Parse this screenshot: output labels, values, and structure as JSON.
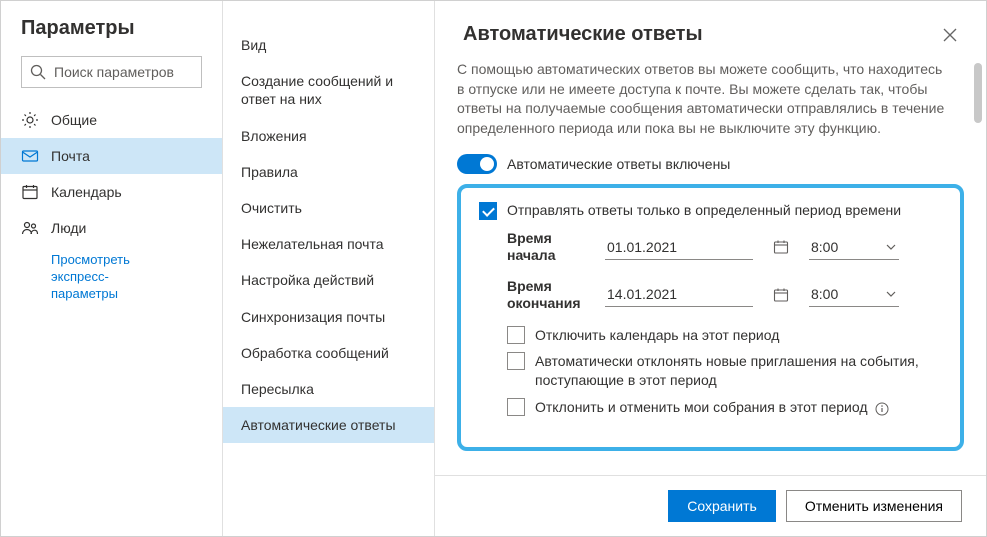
{
  "left": {
    "title": "Параметры",
    "search_placeholder": "Поиск параметров",
    "items": [
      {
        "icon": "gear",
        "label": "Общие"
      },
      {
        "icon": "mail",
        "label": "Почта"
      },
      {
        "icon": "calendar",
        "label": "Календарь"
      },
      {
        "icon": "people",
        "label": "Люди"
      }
    ],
    "quick": {
      "l1": "Просмотреть",
      "l2": "экспресс-",
      "l3": "параметры"
    }
  },
  "mid": {
    "items": [
      "Вид",
      "Создание сообщений и ответ на них",
      "Вложения",
      "Правила",
      "Очистить",
      "Нежелательная почта",
      "Настройка действий",
      "Синхронизация почты",
      "Обработка сообщений",
      "Пересылка",
      "Автоматические ответы"
    ]
  },
  "right": {
    "heading": "Автоматические ответы",
    "intro": "С помощью автоматических ответов вы можете сообщить, что находитесь в отпуске или не имеете доступа к почте. Вы можете сделать так, чтобы ответы на получаемые сообщения автоматически отправлялись в течение определенного периода или пока вы не выключите эту функцию.",
    "toggle_label": "Автоматические ответы включены",
    "period_chk": "Отправлять ответы только в определенный период времени",
    "start_label": "Время начала",
    "end_label": "Время окончания",
    "start_date": "01.01.2021",
    "start_time": "8:00",
    "end_date": "14.01.2021",
    "end_time": "8:00",
    "opts": [
      "Отключить календарь на этот период",
      "Автоматически отклонять новые приглашения на события, поступающие в этот период",
      "Отклонить и отменить мои собрания в этот период"
    ],
    "save": "Сохранить",
    "cancel": "Отменить изменения"
  }
}
